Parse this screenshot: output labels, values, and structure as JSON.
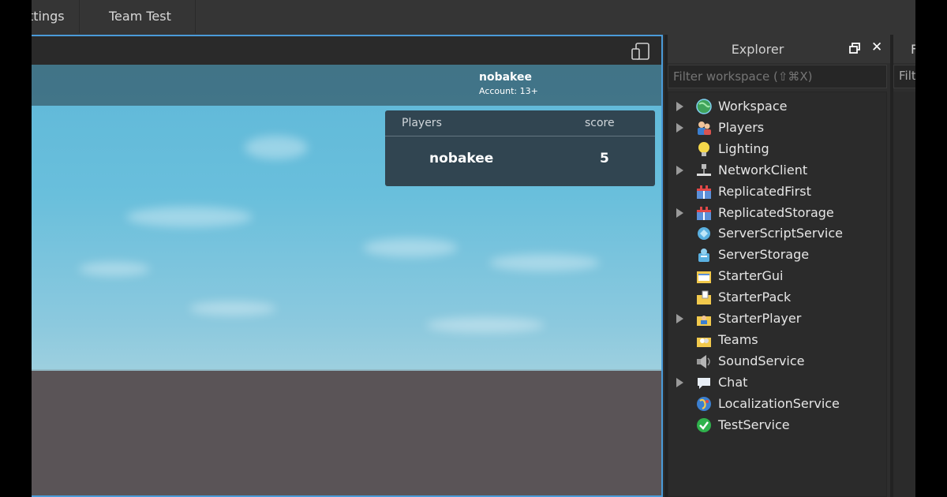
{
  "ribbon": {
    "tabs": [
      "ttings",
      "Team Test"
    ]
  },
  "game": {
    "account": {
      "name": "nobakee",
      "age": "Account: 13+"
    },
    "leaderboard": {
      "headers": [
        "Players",
        "score"
      ],
      "rows": [
        {
          "name": "nobakee",
          "score": "5"
        }
      ]
    }
  },
  "explorer": {
    "title": "Explorer",
    "filter_placeholder": "Filter workspace (⇧⌘X)",
    "items": [
      {
        "label": "Workspace",
        "expandable": true,
        "icon": "workspace-icon"
      },
      {
        "label": "Players",
        "expandable": true,
        "icon": "players-icon"
      },
      {
        "label": "Lighting",
        "expandable": false,
        "icon": "lighting-icon"
      },
      {
        "label": "NetworkClient",
        "expandable": true,
        "icon": "network-client-icon"
      },
      {
        "label": "ReplicatedFirst",
        "expandable": false,
        "icon": "replicated-first-icon"
      },
      {
        "label": "ReplicatedStorage",
        "expandable": true,
        "icon": "replicated-storage-icon"
      },
      {
        "label": "ServerScriptService",
        "expandable": false,
        "icon": "server-script-service-icon"
      },
      {
        "label": "ServerStorage",
        "expandable": false,
        "icon": "server-storage-icon"
      },
      {
        "label": "StarterGui",
        "expandable": false,
        "icon": "starter-gui-icon"
      },
      {
        "label": "StarterPack",
        "expandable": false,
        "icon": "starter-pack-icon"
      },
      {
        "label": "StarterPlayer",
        "expandable": true,
        "icon": "starter-player-icon"
      },
      {
        "label": "Teams",
        "expandable": false,
        "icon": "teams-icon"
      },
      {
        "label": "SoundService",
        "expandable": false,
        "icon": "sound-service-icon"
      },
      {
        "label": "Chat",
        "expandable": true,
        "icon": "chat-icon"
      },
      {
        "label": "LocalizationService",
        "expandable": false,
        "icon": "localization-service-icon"
      },
      {
        "label": "TestService",
        "expandable": false,
        "icon": "test-service-icon"
      }
    ]
  },
  "next_panel": {
    "title_fragment": "F",
    "filter_fragment": "Filt"
  },
  "colors": {
    "accent": "#4a9bd9",
    "panel": "#2e2e2e"
  }
}
